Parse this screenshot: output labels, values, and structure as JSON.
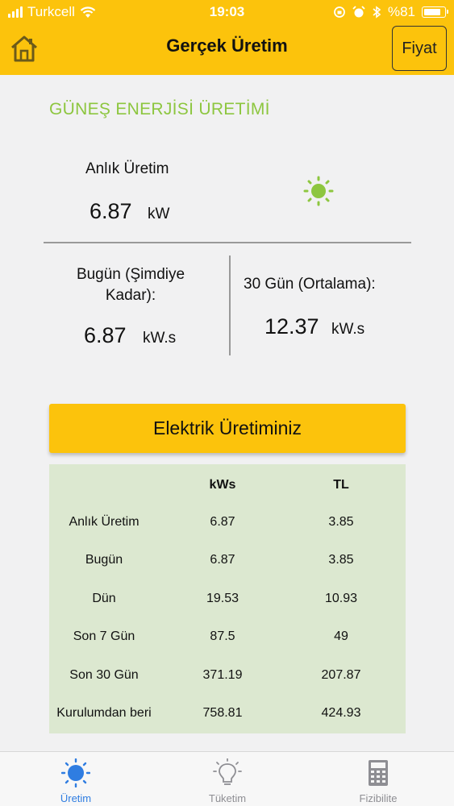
{
  "status_bar": {
    "carrier": "Turkcell",
    "time": "19:03",
    "battery": "%81"
  },
  "header": {
    "title": "Gerçek Üretim",
    "price_button": "Fiyat",
    "home_icon": "home-icon",
    "color": "#fcc30c"
  },
  "solar": {
    "section_title": "GÜNEŞ ENERJİSİ ÜRETİMİ",
    "section_color": "#8dc63f",
    "instant_label": "Anlık Üretim",
    "instant_value": "6.87",
    "instant_unit": "kW",
    "sun_icon": "sun-icon",
    "today_label": "Bugün (Şimdiye Kadar):",
    "today_value": "6.87",
    "today_unit": "kW.s",
    "month_label": "30 Gün (Ortalama):",
    "month_value": "12.37",
    "month_unit": "kW.s"
  },
  "production": {
    "banner": "Elektrik Üretiminiz",
    "table_color": "#dce8d0",
    "columns": [
      "",
      "kWs",
      "TL"
    ],
    "rows": [
      {
        "label": "Anlık Üretim",
        "kws": "6.87",
        "tl": "3.85"
      },
      {
        "label": "Bugün",
        "kws": "6.87",
        "tl": "3.85"
      },
      {
        "label": "Dün",
        "kws": "19.53",
        "tl": "10.93"
      },
      {
        "label": "Son 7 Gün",
        "kws": "87.5",
        "tl": "49"
      },
      {
        "label": "Son 30 Gün",
        "kws": "371.19",
        "tl": "207.87"
      },
      {
        "label": "Kurulumdan beri",
        "kws": "758.81",
        "tl": "424.93"
      }
    ]
  },
  "tabbar": {
    "active_color": "#2f7de1",
    "tabs": [
      {
        "label": "Üretim",
        "icon": "sun-icon",
        "active": true
      },
      {
        "label": "Tüketim",
        "icon": "lightbulb-icon",
        "active": false
      },
      {
        "label": "Fizibilite",
        "icon": "calculator-icon",
        "active": false
      }
    ]
  }
}
